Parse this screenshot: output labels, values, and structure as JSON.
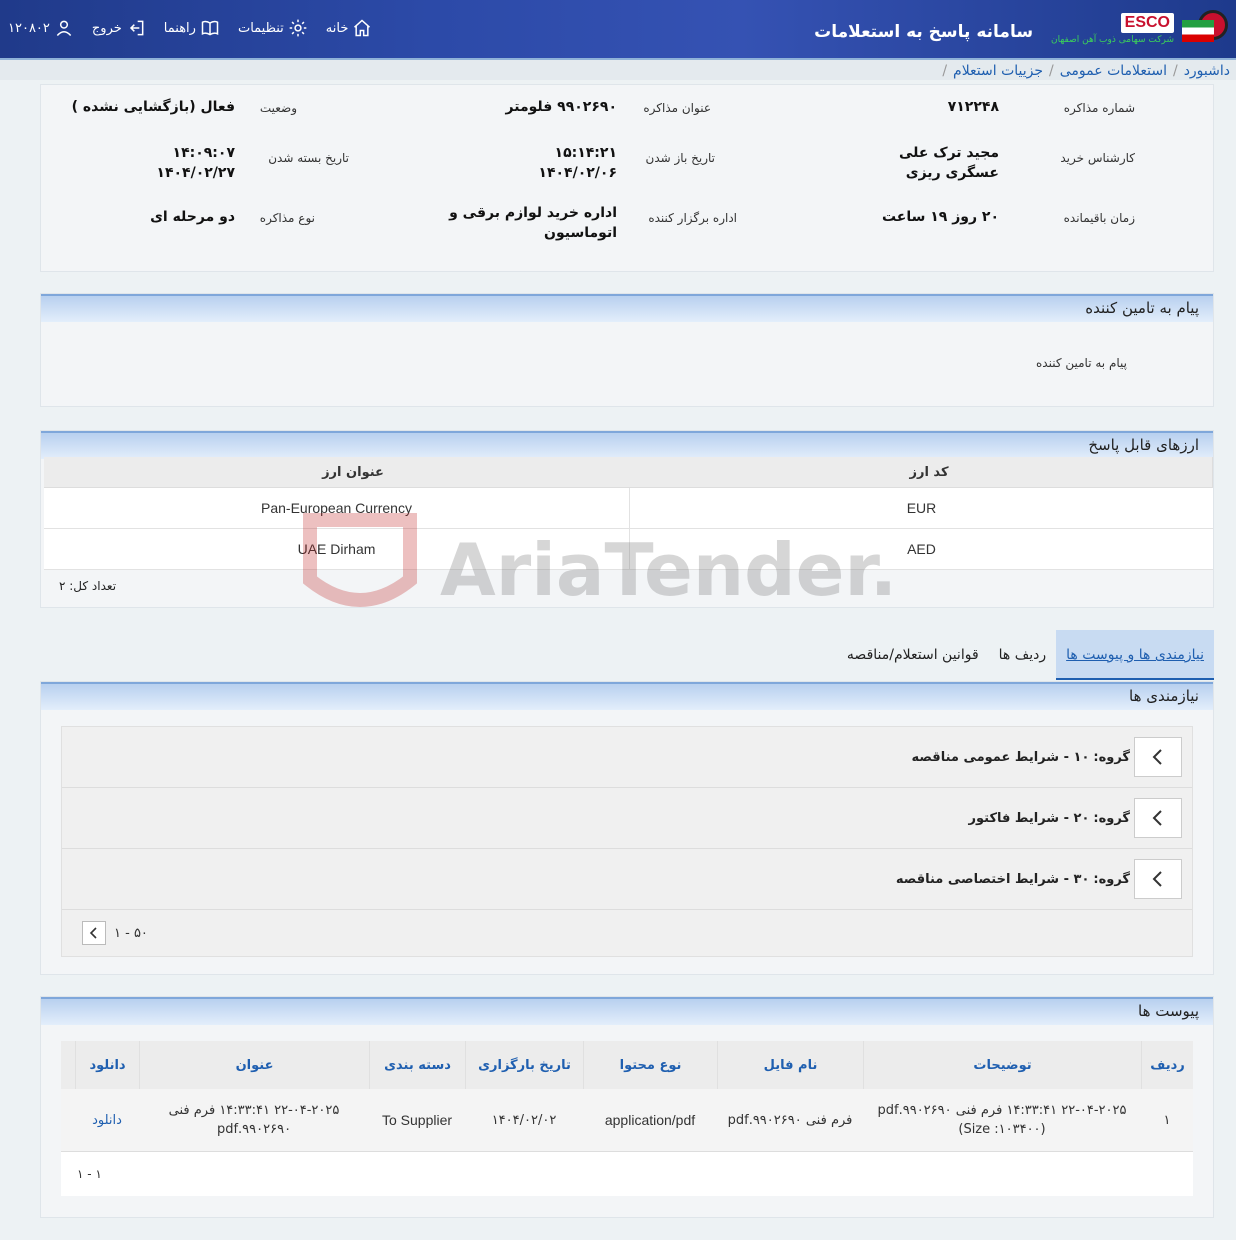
{
  "header": {
    "title": "سامانه پاسخ به استعلامات",
    "brand": "ESCO",
    "company": "شرکت سهامی ذوب آهن اصفهان",
    "nav": {
      "home": "خانه",
      "settings": "تنظیمات",
      "guide": "راهنما",
      "logout": "خروج",
      "user_id": "۱۲۰۸۰۲"
    }
  },
  "breadcrumb": [
    "داشبورد",
    "استعلامات عمومی",
    "جزییات استعلام"
  ],
  "details": {
    "negotiation_number_label": "شماره مذاکره",
    "negotiation_number": "۷۱۲۲۴۸",
    "negotiation_title_label": "عنوان مذاکره",
    "negotiation_title": "۹۹۰۲۶۹۰ فلومتر",
    "status_label": "وضعیت",
    "status": "فعال (بازگشایی نشده )",
    "expert_label": "کارشناس خرید",
    "expert": "مجید ترک علی عسگری ریزی",
    "open_date_label": "تاریخ باز شدن",
    "open_time": "۱۵:۱۴:۲۱",
    "open_date": "۱۴۰۴/۰۲/۰۶",
    "close_date_label": "تاریخ بسته شدن",
    "close_time": "۱۴:۰۹:۰۷",
    "close_date": "۱۴۰۴/۰۲/۲۷",
    "remaining_label": "زمان باقیمانده",
    "remaining": "۲۰ روز ۱۹ ساعت",
    "organizer_label": "اداره برگزار کننده",
    "organizer": "اداره خرید لوازم برقی و اتوماسیون",
    "type_label": "نوع مذاکره",
    "type": "دو مرحله ای"
  },
  "supplier_message": {
    "title": "پیام به تامین کننده",
    "label": "پیام به تامین کننده"
  },
  "currencies": {
    "title": "ارزهای قابل پاسخ",
    "col_code": "کد ارز",
    "col_title": "عنوان ارز",
    "rows": [
      {
        "code": "EUR",
        "title": "Pan-European Currency"
      },
      {
        "code": "AED",
        "title": "UAE Dirham"
      }
    ],
    "total": "تعداد کل: ۲"
  },
  "tabs": [
    "نیازمندی ها و پیوست ها",
    "ردیف ها",
    "قوانین استعلام/مناقصه"
  ],
  "requirements": {
    "title": "نیازمندی ها",
    "groups": [
      {
        "prefix": "گروه:",
        "text": "۱۰ - شرایط عمومی مناقصه"
      },
      {
        "prefix": "گروه:",
        "text": "۲۰ - شرایط فاکتور"
      },
      {
        "prefix": "گروه:",
        "text": "۳۰ - شرایط اختصاصی مناقصه"
      }
    ],
    "pager": "۱ - ۵۰"
  },
  "attachments": {
    "title": "پیوست ها",
    "headers": [
      "ردیف",
      "توضیحات",
      "نام فایل",
      "نوع محتوا",
      "تاریخ بارگزاری",
      "دسته بندی",
      "عنوان",
      "دانلود"
    ],
    "rows": [
      {
        "row": "۱",
        "description": "۲۲-۰۴-۲۰۲۵ ۱۴:۳۳:۴۱ فرم فنی ۹۹۰۲۶۹۰.pdf (Size :۱۰۳۴۰۰)",
        "filename": "فرم فنی ۹۹۰۲۶۹۰.pdf",
        "content_type": "application/pdf",
        "upload_date": "۱۴۰۴/۰۲/۰۲",
        "category": "To Supplier",
        "title": "۲۲-۰۴-۲۰۲۵ ۱۴:۳۳:۴۱ فرم فنی ۹۹۰۲۶۹۰.pdf",
        "download": "دانلود"
      }
    ],
    "pager": "۱ - ۱"
  },
  "watermark": "AriaTender.neT",
  "colors": {
    "header_bg": "#2c4aa8",
    "link": "#1f5fb0",
    "panel_head": "#b8d0ef"
  }
}
